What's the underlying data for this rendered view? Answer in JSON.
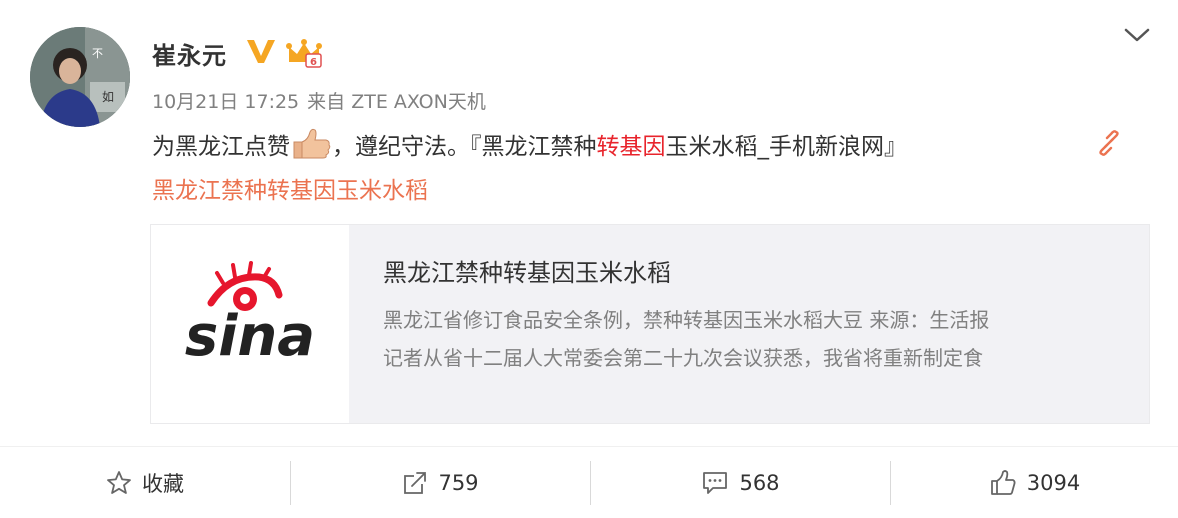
{
  "post": {
    "user_name": "崔永元",
    "timestamp": "10月21日 17:25",
    "source": "来自 ZTE AXON天机",
    "text_before": "为黑龙江点赞",
    "text_middle": "，遵纪守法。『黑龙江禁种",
    "text_highlight": "转基因",
    "text_after": "玉米水稻_手机新浪网』",
    "topic_link": "黑龙江禁种转基因玉米水稻"
  },
  "preview": {
    "title": "黑龙江禁种转基因玉米水稻",
    "desc_line1": "黑龙江省修订食品安全条例，禁种转基因玉米水稻大豆 来源：生活报",
    "desc_line2": "记者从省十二届人大常委会第二十九次会议获悉，我省将重新制定食",
    "logo_text": "sina"
  },
  "actions": {
    "favorite_label": "收藏",
    "repost_count": "759",
    "comment_count": "568",
    "like_count": "3094"
  },
  "icons": {
    "vip": "verified-v-icon",
    "member": "member-crown-icon",
    "expand": "chevron-down-icon",
    "link": "link-icon",
    "favorite": "star-icon",
    "repost": "share-icon",
    "comment": "comment-icon",
    "like": "thumbs-up-icon"
  },
  "colors": {
    "highlight_red": "#e8242c",
    "topic_orange": "#eb7350",
    "vip_gold": "#f5a623",
    "sina_red": "#e6162d"
  }
}
